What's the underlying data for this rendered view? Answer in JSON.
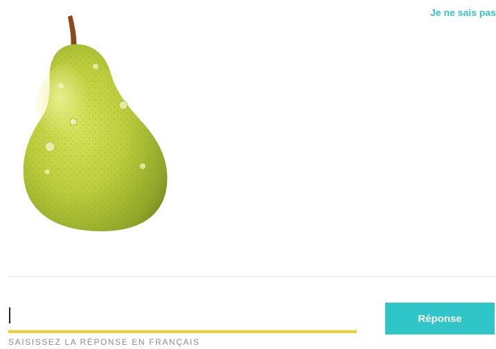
{
  "header": {
    "skip_label": "Je ne sais pas"
  },
  "prompt": {
    "image_icon": "pear-image"
  },
  "answer": {
    "value": "",
    "hint": "SAISISSEZ LA RÉPONSE EN FRANÇAIS"
  },
  "actions": {
    "submit_label": "Réponse"
  },
  "colors": {
    "accent": "#30c5c9",
    "underline": "#f4cc2e",
    "hint": "#8c8c8c",
    "divider": "#e4e4e4"
  }
}
